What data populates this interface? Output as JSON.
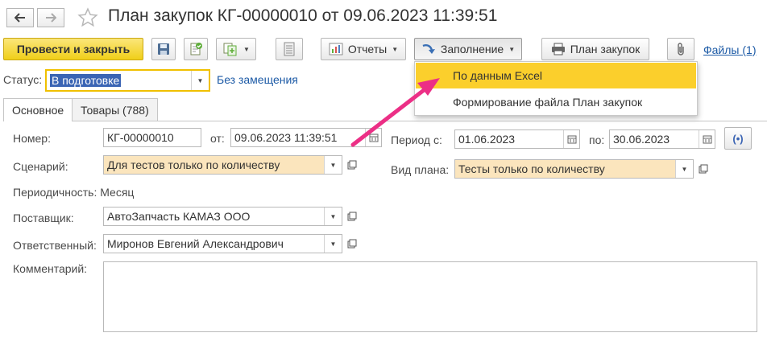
{
  "window": {
    "title": "План закупок КГ-00000010 от 09.06.2023 11:39:51"
  },
  "nav": {
    "back_icon": "arrow-left-icon",
    "forward_icon": "arrow-right-icon",
    "favorite_icon": "star-icon"
  },
  "toolbar": {
    "post_close_label": "Провести и закрыть",
    "reports_label": "Отчеты",
    "fill_label": "Заполнение",
    "plan_label": "План закупок",
    "files_label": "Файлы (1)"
  },
  "status": {
    "label": "Статус:",
    "value": "В подготовке",
    "link": "Без замещения"
  },
  "tabs": [
    {
      "label": "Основное"
    },
    {
      "label": "Товары (788)"
    }
  ],
  "fill_menu": {
    "items": [
      {
        "label": "По данным Excel"
      },
      {
        "label": "Формирование файла План закупок"
      }
    ]
  },
  "form": {
    "number_label": "Номер:",
    "number_value": "КГ-00000010",
    "date_label": "от:",
    "date_value": "09.06.2023 11:39:51",
    "period_from_label": "Период с:",
    "period_from_value": "01.06.2023",
    "period_to_label": "по:",
    "period_to_value": "30.06.2023",
    "scenario_label": "Сценарий:",
    "scenario_value": "Для тестов только по количеству",
    "plan_type_label": "Вид плана:",
    "plan_type_value": "Тесты только по количеству",
    "periodicity_text": "Периодичность: Месяц",
    "supplier_label": "Поставщик:",
    "supplier_value": "АвтоЗапчасть КАМАЗ ООО",
    "responsible_label": "Ответственный:",
    "responsible_value": "Миронов Евгений Александрович",
    "comment_label": "Комментарий:",
    "comment_value": ""
  },
  "colors": {
    "accent_yellow": "#f0cf19",
    "menu_highlight": "#fbcf2c",
    "field_highlight": "#fbe5bd",
    "annotation_arrow": "#ec2f86",
    "link": "#1c5aa6"
  }
}
